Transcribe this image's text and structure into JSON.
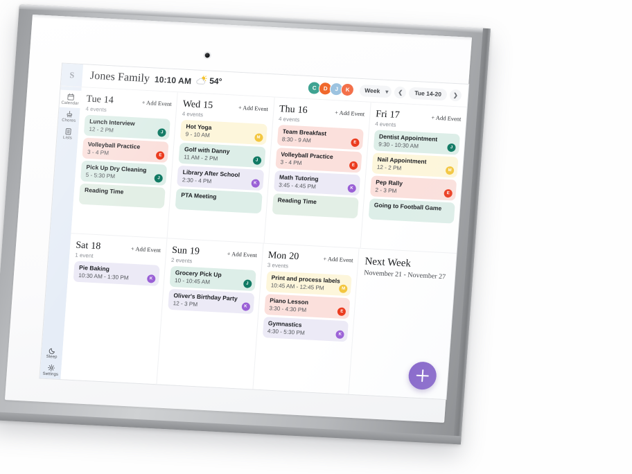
{
  "device": {
    "camera": "camera-dot"
  },
  "header": {
    "brand_initial": "S",
    "family_title": "Jones Family",
    "clock": "10:10 AM",
    "weather_icon": "sun-behind-cloud-icon",
    "temperature": "54°",
    "avatars": [
      {
        "initial": "C",
        "color": "#3fa392"
      },
      {
        "initial": "D",
        "color": "#f0682c"
      },
      {
        "initial": "J",
        "color": "#9cc3e0"
      },
      {
        "initial": "K",
        "color": "#f3704a"
      }
    ],
    "view_select": {
      "label": "Week",
      "icon": "chevron-down-icon"
    },
    "prev_icon": "chevron-left-icon",
    "date_range": "Tue 14-20",
    "next_icon": "chevron-right-icon"
  },
  "sidebar": {
    "items": [
      {
        "label": "Calendar",
        "icon": "calendar-icon",
        "active": true
      },
      {
        "label": "Chores",
        "icon": "broom-icon",
        "active": false
      },
      {
        "label": "Lists",
        "icon": "list-icon",
        "active": false
      }
    ],
    "bottom_items": [
      {
        "label": "Sleep",
        "icon": "moon-icon"
      },
      {
        "label": "Settings",
        "icon": "gear-icon"
      }
    ]
  },
  "add_event_label": "+ Add Event",
  "palette": {
    "mint": "#ddeee8",
    "blush": "#fbe0dc",
    "cream": "#fdf6db",
    "lilac": "#eceaf6",
    "av_teal": "#117a64",
    "av_red": "#eb3b1e",
    "av_purple": "#9a60d6",
    "av_yellow": "#f3c63f",
    "fab": "#7a55c4"
  },
  "days": [
    {
      "name": "Tue",
      "num": "14",
      "count": "4 events",
      "events": [
        {
          "title": "Lunch Interview",
          "time": "12 - 2 PM",
          "bg": "#ddeee8",
          "avatar": "J",
          "avatar_color": "#117a64"
        },
        {
          "title": "Volleyball Practice",
          "time": "3 - 4 PM",
          "bg": "#fbe0dc",
          "avatar": "E",
          "avatar_color": "#eb3b1e"
        },
        {
          "title": "Pick Up Dry Cleaning",
          "time": "5 - 5:30 PM",
          "bg": "#ddeee8",
          "avatar": "J",
          "avatar_color": "#117a64"
        },
        {
          "title": "Reading Time",
          "time": "",
          "bg": "#e3efe6",
          "avatar": "",
          "avatar_color": ""
        }
      ]
    },
    {
      "name": "Wed",
      "num": "15",
      "count": "4 events",
      "events": [
        {
          "title": "Hot Yoga",
          "time": "9 - 10 AM",
          "bg": "#fdf6db",
          "avatar": "M",
          "avatar_color": "#f3c63f"
        },
        {
          "title": "Golf with Danny",
          "time": "11 AM - 2 PM",
          "bg": "#ddeee8",
          "avatar": "J",
          "avatar_color": "#117a64"
        },
        {
          "title": "Library After School",
          "time": "2:30 - 4 PM",
          "bg": "#eceaf6",
          "avatar": "K",
          "avatar_color": "#9a60d6"
        },
        {
          "title": "PTA Meeting",
          "time": "",
          "bg": "#ddeee8",
          "avatar": "",
          "avatar_color": ""
        }
      ]
    },
    {
      "name": "Thu",
      "num": "16",
      "count": "4 events",
      "events": [
        {
          "title": "Team Breakfast",
          "time": "8:30 - 9 AM",
          "bg": "#fbe0dc",
          "avatar": "E",
          "avatar_color": "#eb3b1e"
        },
        {
          "title": "Volleyball Practice",
          "time": "3 - 4 PM",
          "bg": "#fbe0dc",
          "avatar": "E",
          "avatar_color": "#eb3b1e"
        },
        {
          "title": "Math Tutoring",
          "time": "3:45 - 4:45 PM",
          "bg": "#eceaf6",
          "avatar": "K",
          "avatar_color": "#9a60d6"
        },
        {
          "title": "Reading Time",
          "time": "",
          "bg": "#e3efe6",
          "avatar": "",
          "avatar_color": ""
        }
      ]
    },
    {
      "name": "Fri",
      "num": "17",
      "count": "4 events",
      "events": [
        {
          "title": "Dentist Appointment",
          "time": "9:30 - 10:30 AM",
          "bg": "#ddeee8",
          "avatar": "J",
          "avatar_color": "#117a64"
        },
        {
          "title": "Nail Appointment",
          "time": "12 - 2 PM",
          "bg": "#fdf6db",
          "avatar": "M",
          "avatar_color": "#f3c63f"
        },
        {
          "title": "Pep Rally",
          "time": "2 - 3 PM",
          "bg": "#fbe0dc",
          "avatar": "E",
          "avatar_color": "#eb3b1e"
        },
        {
          "title": "Going to Football Game",
          "time": "",
          "bg": "#ddeee8",
          "avatar": "",
          "avatar_color": ""
        }
      ]
    },
    {
      "name": "Sat",
      "num": "18",
      "count": "1 event",
      "events": [
        {
          "title": "Pie Baking",
          "time": "10:30 AM - 1:30 PM",
          "bg": "#eceaf6",
          "avatar": "K",
          "avatar_color": "#9a60d6"
        }
      ]
    },
    {
      "name": "Sun",
      "num": "19",
      "count": "2 events",
      "events": [
        {
          "title": "Grocery Pick Up",
          "time": "10 - 10:45 AM",
          "bg": "#ddeee8",
          "avatar": "J",
          "avatar_color": "#117a64"
        },
        {
          "title": "Oliver's Birthday Party",
          "time": "12 - 3 PM",
          "bg": "#eceaf6",
          "avatar": "K",
          "avatar_color": "#9a60d6"
        }
      ]
    },
    {
      "name": "Mon",
      "num": "20",
      "count": "3 events",
      "events": [
        {
          "title": "Print and process labels",
          "time": "10:45 AM - 12:45 PM",
          "bg": "#fdf6db",
          "avatar": "M",
          "avatar_color": "#f3c63f"
        },
        {
          "title": "Piano Lesson",
          "time": "3:30 - 4:30 PM",
          "bg": "#fbe0dc",
          "avatar": "E",
          "avatar_color": "#eb3b1e"
        },
        {
          "title": "Gymnastics",
          "time": "4:30 - 5:30 PM",
          "bg": "#eceaf6",
          "avatar": "K",
          "avatar_color": "#9a60d6"
        }
      ]
    }
  ],
  "next_week": {
    "title": "Next Week",
    "range": "November 21 - November 27"
  },
  "fab": {
    "icon": "plus-icon",
    "label": "+"
  }
}
